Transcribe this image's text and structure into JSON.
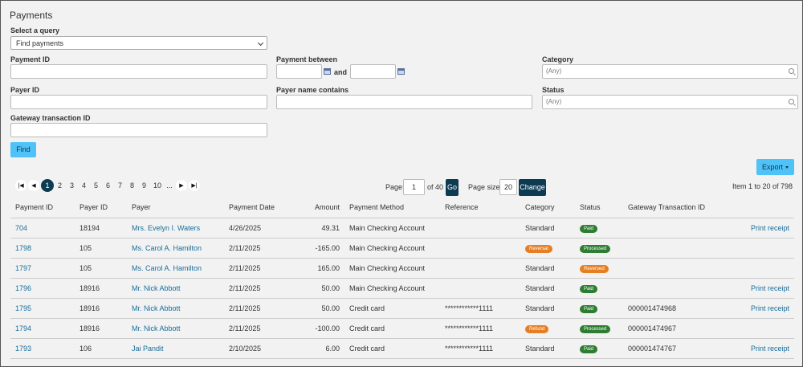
{
  "page_title": "Payments",
  "query": {
    "label": "Select a query",
    "selected": "Find payments"
  },
  "filters": {
    "payment_id_label": "Payment ID",
    "payment_between_label": "Payment between",
    "and_label": "and",
    "category_label": "Category",
    "category_placeholder": "(Any)",
    "payer_id_label": "Payer ID",
    "payer_name_label": "Payer name contains",
    "status_label": "Status",
    "status_placeholder": "(Any)",
    "gateway_label": "Gateway transaction ID"
  },
  "buttons": {
    "find": "Find",
    "export": "Export"
  },
  "pager": {
    "first": "|◀",
    "prev": "◀",
    "pages": [
      "1",
      "2",
      "3",
      "4",
      "5",
      "6",
      "7",
      "8",
      "9",
      "10"
    ],
    "active_page": "1",
    "ellipsis": "...",
    "next": "▶",
    "last": "▶|",
    "page_label": "Page:",
    "page_value": "1",
    "of_pages": "of 40",
    "go": "Go",
    "page_size_label": "Page size:",
    "page_size_value": "20",
    "change": "Change",
    "items_info": "Item 1 to 20 of 798"
  },
  "colors": {
    "badge_paid": "#2e7d32",
    "badge_processed": "#2e7d32",
    "badge_reversal": "#e67e22",
    "badge_refund": "#e67e22",
    "accent": "#4fc3f7",
    "dark": "#0d3b52"
  },
  "table": {
    "columns": [
      "Payment ID",
      "Payer ID",
      "Payer",
      "Payment Date",
      "Amount",
      "Payment Method",
      "Reference",
      "Category",
      "Status",
      "Gateway Transaction ID",
      ""
    ],
    "rows": [
      {
        "payment_id": "704",
        "payer_id": "18194",
        "payer": "Mrs. Evelyn I. Waters",
        "date": "4/26/2025",
        "amount": "49.31",
        "method": "Main Checking Account",
        "reference": "",
        "category": "Standard",
        "category_badge": "",
        "status": "Paid",
        "gateway": "",
        "action": "Print receipt"
      },
      {
        "payment_id": "1798",
        "payer_id": "105",
        "payer": "Ms. Carol A. Hamilton",
        "date": "2/11/2025",
        "amount": "-165.00",
        "method": "Main Checking Account",
        "reference": "",
        "category": "",
        "category_badge": "Reversal",
        "status": "Processed",
        "gateway": "",
        "action": ""
      },
      {
        "payment_id": "1797",
        "payer_id": "105",
        "payer": "Ms. Carol A. Hamilton",
        "date": "2/11/2025",
        "amount": "165.00",
        "method": "Main Checking Account",
        "reference": "",
        "category": "Standard",
        "category_badge": "",
        "status": "Reversed",
        "gateway": "",
        "action": ""
      },
      {
        "payment_id": "1796",
        "payer_id": "18916",
        "payer": "Mr. Nick Abbott",
        "date": "2/11/2025",
        "amount": "50.00",
        "method": "Main Checking Account",
        "reference": "",
        "category": "Standard",
        "category_badge": "",
        "status": "Paid",
        "gateway": "",
        "action": "Print receipt"
      },
      {
        "payment_id": "1795",
        "payer_id": "18916",
        "payer": "Mr. Nick Abbott",
        "date": "2/11/2025",
        "amount": "50.00",
        "method": "Credit card",
        "reference": "************1111",
        "category": "Standard",
        "category_badge": "",
        "status": "Paid",
        "gateway": "000001474968",
        "action": "Print receipt"
      },
      {
        "payment_id": "1794",
        "payer_id": "18916",
        "payer": "Mr. Nick Abbott",
        "date": "2/11/2025",
        "amount": "-100.00",
        "method": "Credit card",
        "reference": "************1111",
        "category": "",
        "category_badge": "Refund",
        "status": "Processed",
        "gateway": "000001474967",
        "action": ""
      },
      {
        "payment_id": "1793",
        "payer_id": "106",
        "payer": "Jai Pandit",
        "date": "2/10/2025",
        "amount": "6.00",
        "method": "Credit card",
        "reference": "************1111",
        "category": "Standard",
        "category_badge": "",
        "status": "Paid",
        "gateway": "000001474767",
        "action": "Print receipt"
      }
    ]
  }
}
